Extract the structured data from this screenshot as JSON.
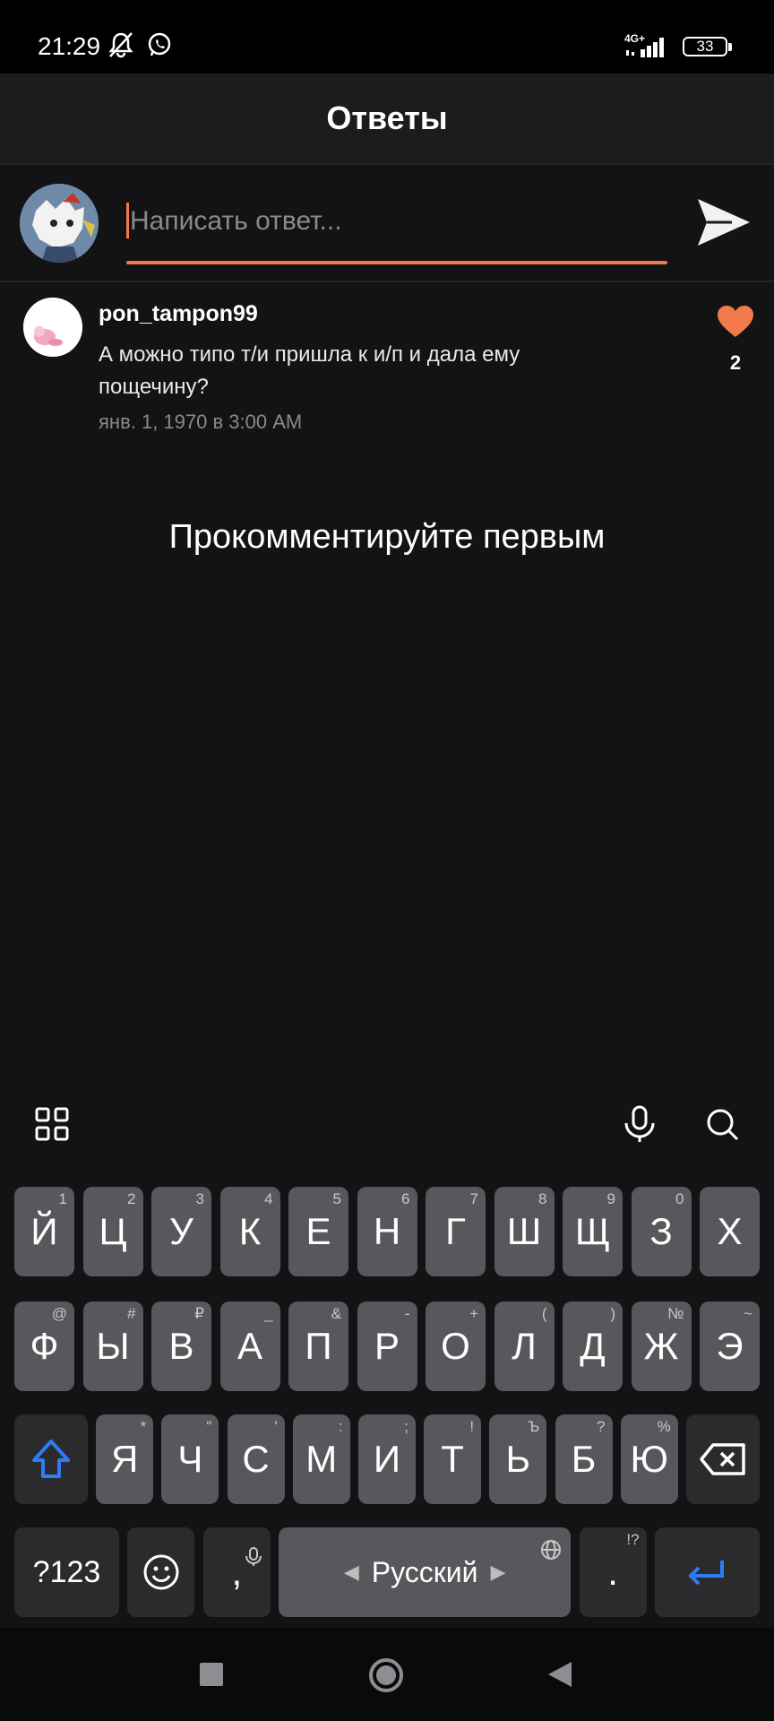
{
  "status_bar": {
    "time": "21:29",
    "network": "4G+",
    "battery": "33"
  },
  "header": {
    "title": "Ответы"
  },
  "compose": {
    "placeholder": "Написать ответ...",
    "accent_color": "#f07a4a"
  },
  "comment": {
    "username": "pon_tampon99",
    "text": "А можно типо т/и пришла к и/п и дала ему пощечину?",
    "date": "янв. 1, 1970 в 3:00 AM",
    "likes": "2",
    "heart_color": "#f07a4a"
  },
  "empty_state": "Прокомментируйте первым",
  "keyboard": {
    "row1": [
      {
        "label": "Й",
        "hint": "1"
      },
      {
        "label": "Ц",
        "hint": "2"
      },
      {
        "label": "У",
        "hint": "3"
      },
      {
        "label": "К",
        "hint": "4"
      },
      {
        "label": "Е",
        "hint": "5"
      },
      {
        "label": "Н",
        "hint": "6"
      },
      {
        "label": "Г",
        "hint": "7"
      },
      {
        "label": "Ш",
        "hint": "8"
      },
      {
        "label": "Щ",
        "hint": "9"
      },
      {
        "label": "З",
        "hint": "0"
      },
      {
        "label": "Х",
        "hint": ""
      }
    ],
    "row2": [
      {
        "label": "Ф",
        "hint": "@"
      },
      {
        "label": "Ы",
        "hint": "#"
      },
      {
        "label": "В",
        "hint": "₽"
      },
      {
        "label": "А",
        "hint": "_"
      },
      {
        "label": "П",
        "hint": "&"
      },
      {
        "label": "Р",
        "hint": "-"
      },
      {
        "label": "О",
        "hint": "+"
      },
      {
        "label": "Л",
        "hint": "("
      },
      {
        "label": "Д",
        "hint": ")"
      },
      {
        "label": "Ж",
        "hint": "№"
      },
      {
        "label": "Э",
        "hint": "~"
      }
    ],
    "row3": [
      {
        "label": "Я",
        "hint": "*"
      },
      {
        "label": "Ч",
        "hint": "\""
      },
      {
        "label": "С",
        "hint": "'"
      },
      {
        "label": "М",
        "hint": ":"
      },
      {
        "label": "И",
        "hint": ";"
      },
      {
        "label": "Т",
        "hint": "!"
      },
      {
        "label": "Ь",
        "hint": "Ъ"
      },
      {
        "label": "Б",
        "hint": "?"
      },
      {
        "label": "Ю",
        "hint": "%"
      }
    ],
    "symbols_label": "?123",
    "comma_label": ",",
    "space_label": "Русский",
    "period_label": ".",
    "period_hint": "!?",
    "action_color": "#2e7cf6"
  }
}
